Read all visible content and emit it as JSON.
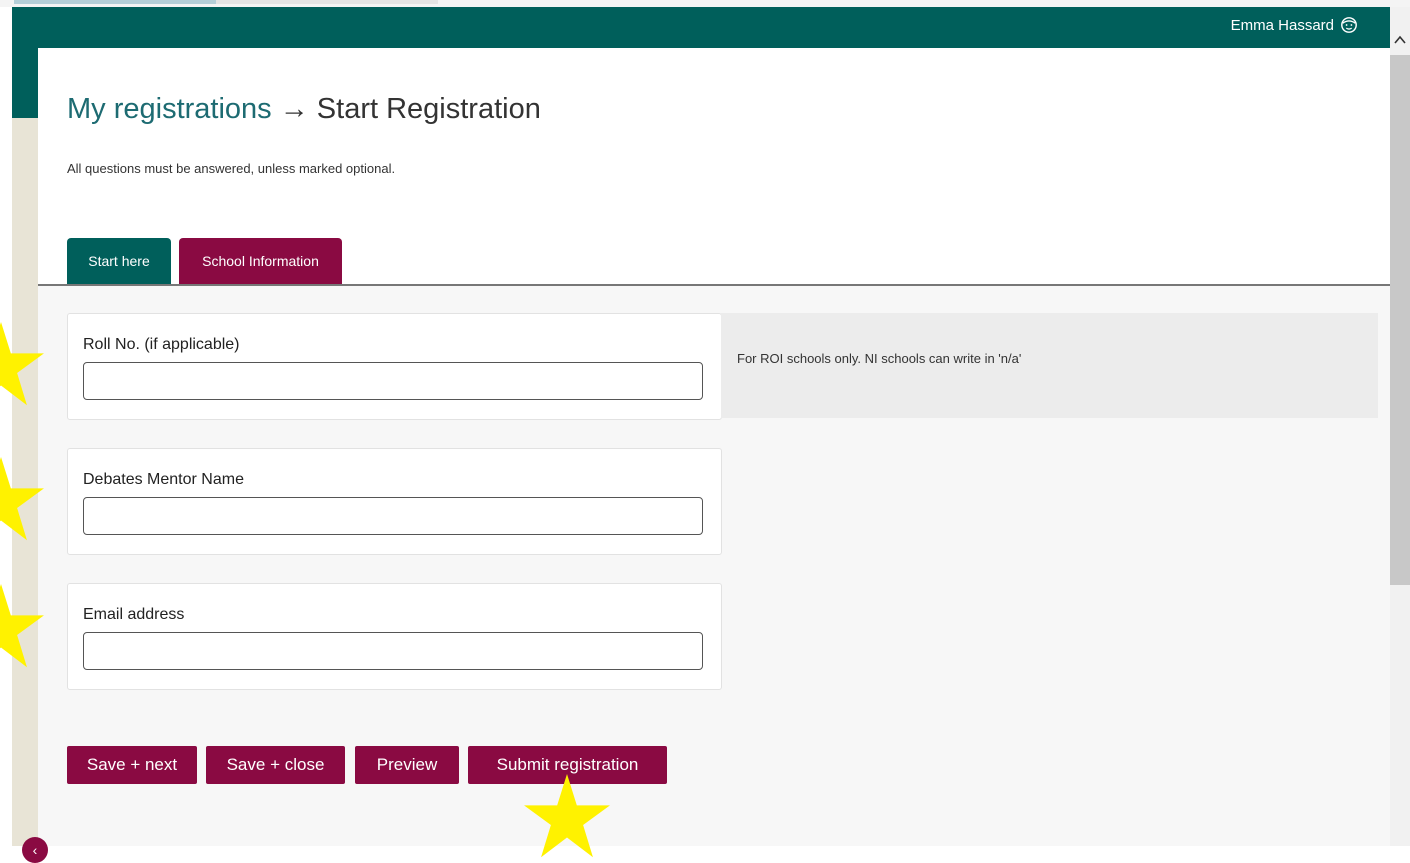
{
  "header": {
    "user_name": "Emma Hassard",
    "user_icon": "user-face-icon",
    "scroll_up_icon": "chevron-up-icon"
  },
  "page": {
    "breadcrumb_link": "My registrations",
    "breadcrumb_arrow": "→",
    "title": "Start Registration",
    "instruction": "All questions must be answered, unless marked optional."
  },
  "tabs": [
    {
      "label": "Start here",
      "active": false
    },
    {
      "label": "School Information",
      "active": true
    }
  ],
  "form": {
    "fields": [
      {
        "label": "Roll No. (if applicable)",
        "value": "",
        "placeholder": ""
      },
      {
        "label": "Debates Mentor Name",
        "value": "",
        "placeholder": ""
      },
      {
        "label": "Email address",
        "value": "",
        "placeholder": ""
      }
    ],
    "roll_help": "For ROI schools only. NI schools can write in 'n/a'"
  },
  "actions": {
    "save_next": "Save + next",
    "save_close": "Save + close",
    "preview": "Preview",
    "submit": "Submit registration"
  },
  "sidebar": {
    "collapse_icon": "chevron-left-icon",
    "collapse_glyph": "‹"
  },
  "colors": {
    "header": "#005f5b",
    "accent": "#8a0a42",
    "link": "#1d6b72",
    "star": "#fff200"
  }
}
